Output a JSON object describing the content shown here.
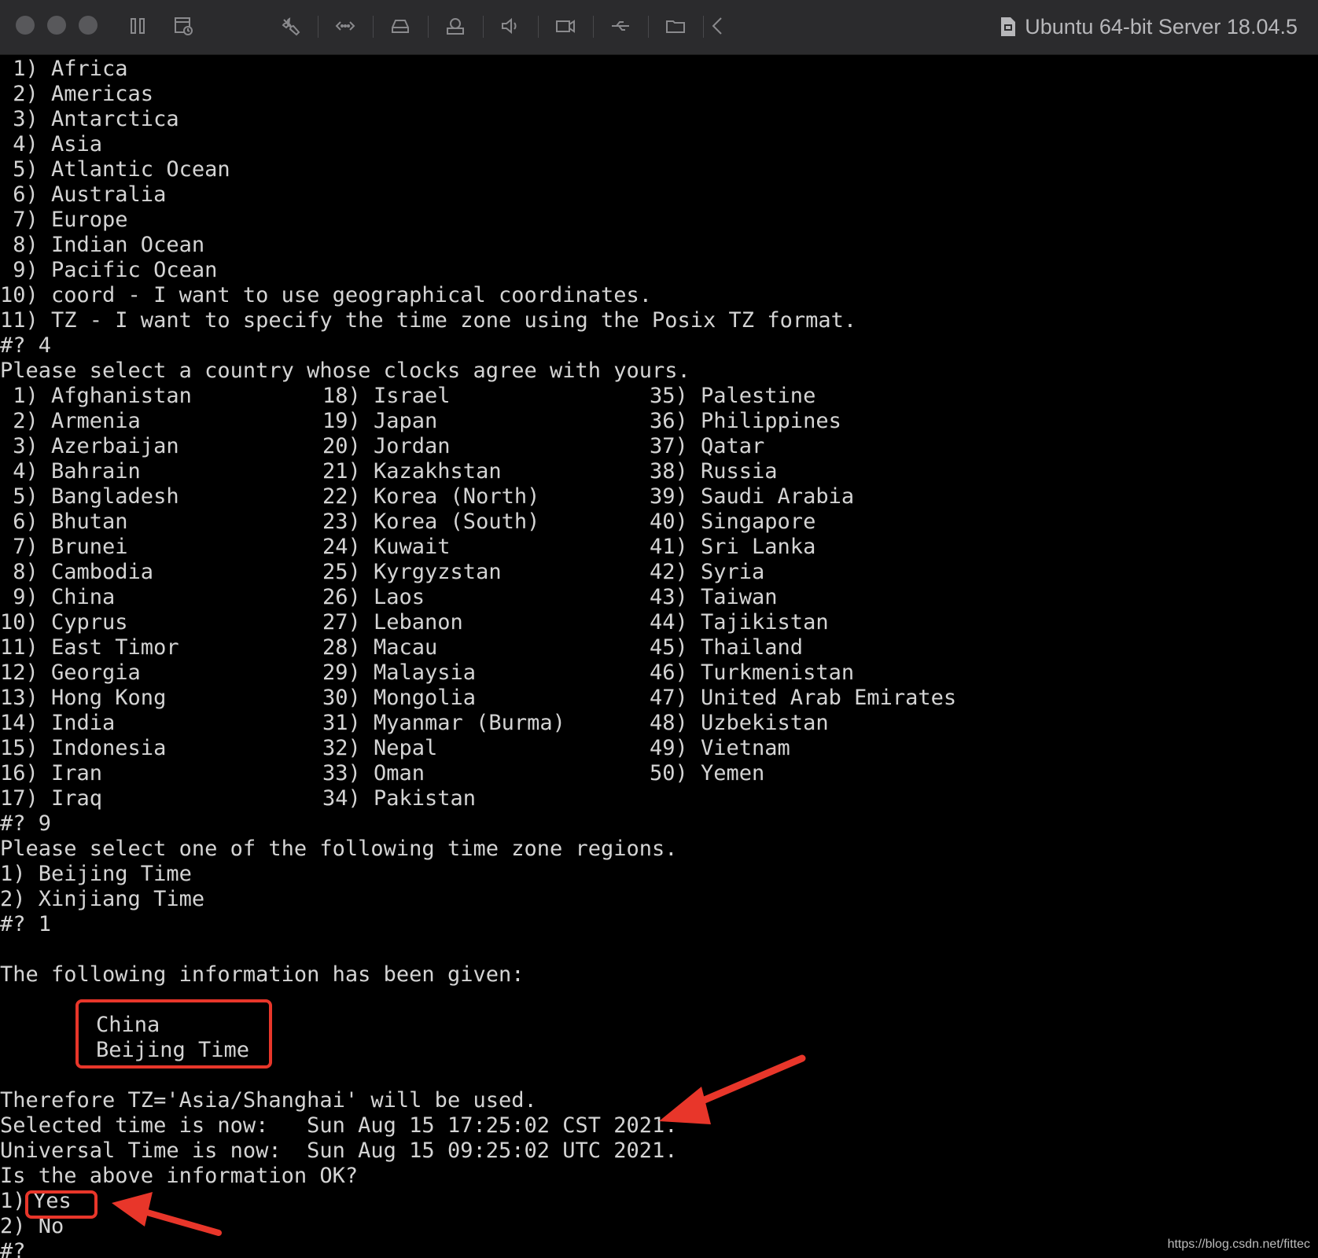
{
  "window": {
    "title": "Ubuntu 64-bit Server 18.04.5"
  },
  "toolbar": {
    "icons": [
      "traffic-close",
      "traffic-minimize",
      "traffic-zoom",
      "suspend-icon",
      "snapshot-icon",
      "settings-wrench-icon",
      "network-icon",
      "harddisk-icon",
      "printer-icon",
      "sound-icon",
      "camera-icon",
      "usb-icon",
      "shared-folder-icon",
      "back-chevron-icon"
    ]
  },
  "terminal": {
    "continents": [
      " 1) Africa",
      " 2) Americas",
      " 3) Antarctica",
      " 4) Asia",
      " 5) Atlantic Ocean",
      " 6) Australia",
      " 7) Europe",
      " 8) Indian Ocean",
      " 9) Pacific Ocean",
      "10) coord - I want to use geographical coordinates.",
      "11) TZ - I want to specify the time zone using the Posix TZ format."
    ],
    "prompt_continent": "#? 4",
    "country_prompt": "Please select a country whose clocks agree with yours.",
    "countries_col1": [
      " 1) Afghanistan",
      " 2) Armenia",
      " 3) Azerbaijan",
      " 4) Bahrain",
      " 5) Bangladesh",
      " 6) Bhutan",
      " 7) Brunei",
      " 8) Cambodia",
      " 9) China",
      "10) Cyprus",
      "11) East Timor",
      "12) Georgia",
      "13) Hong Kong",
      "14) India",
      "15) Indonesia",
      "16) Iran",
      "17) Iraq"
    ],
    "countries_col2": [
      "18) Israel",
      "19) Japan",
      "20) Jordan",
      "21) Kazakhstan",
      "22) Korea (North)",
      "23) Korea (South)",
      "24) Kuwait",
      "25) Kyrgyzstan",
      "26) Laos",
      "27) Lebanon",
      "28) Macau",
      "29) Malaysia",
      "30) Mongolia",
      "31) Myanmar (Burma)",
      "32) Nepal",
      "33) Oman",
      "34) Pakistan"
    ],
    "countries_col3": [
      "35) Palestine",
      "36) Philippines",
      "37) Qatar",
      "38) Russia",
      "39) Saudi Arabia",
      "40) Singapore",
      "41) Sri Lanka",
      "42) Syria",
      "43) Taiwan",
      "44) Tajikistan",
      "45) Thailand",
      "46) Turkmenistan",
      "47) United Arab Emirates",
      "48) Uzbekistan",
      "49) Vietnam",
      "50) Yemen"
    ],
    "prompt_country": "#? 9",
    "region_prompt": "Please select one of the following time zone regions.",
    "regions": [
      "1) Beijing Time",
      "2) Xinjiang Time"
    ],
    "prompt_region": "#? 1",
    "info_heading": "The following information has been given:",
    "info_country": "China",
    "info_region": "Beijing Time",
    "tz_line": "Therefore TZ='Asia/Shanghai' will be used.",
    "selected_time": "Selected time is now:   Sun Aug 15 17:25:02 CST 2021.",
    "universal_time": "Universal Time is now:  Sun Aug 15 09:25:02 UTC 2021.",
    "confirm_question": "Is the above information OK?",
    "option_yes_num": "1) ",
    "option_yes": "Yes",
    "option_no": "2) No",
    "final_prompt": "#?"
  },
  "annotations": {
    "color": "#e8362a"
  },
  "watermark": "https://blog.csdn.net/fittec"
}
